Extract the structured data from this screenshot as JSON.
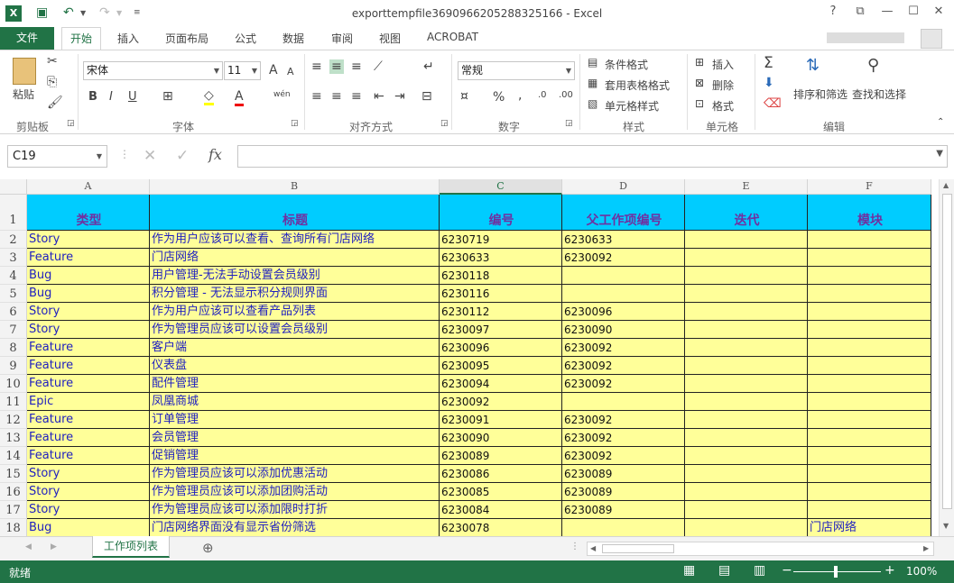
{
  "window": {
    "title": "exporttempfile3690966205288325166 - Excel",
    "help": "?",
    "restore_ribbon": "⧉",
    "minimize": "—",
    "maximize": "☐",
    "close": "✕"
  },
  "tabs": [
    "文件",
    "开始",
    "插入",
    "页面布局",
    "公式",
    "数据",
    "审阅",
    "视图",
    "ACROBAT"
  ],
  "ribbon": {
    "clipboard": {
      "paste": "粘贴",
      "group": "剪贴板"
    },
    "font": {
      "name": "宋体",
      "size": "11",
      "group": "字体",
      "bold": "B",
      "italic": "I",
      "underline": "U",
      "grow": "A",
      "shrink": "A",
      "color_a": "A",
      "phonetic": "wén"
    },
    "alignment": {
      "group": "对齐方式"
    },
    "number": {
      "format": "常规",
      "percent": "%",
      "comma": ",",
      "group": "数字"
    },
    "styles": {
      "conditional": "条件格式",
      "table": "套用表格格式",
      "cell": "单元格样式",
      "group": "样式"
    },
    "cells": {
      "insert": "插入",
      "delete": "删除",
      "format": "格式",
      "group": "单元格"
    },
    "editing": {
      "sort": "排序和筛选",
      "find": "查找和选择",
      "group": "编辑"
    }
  },
  "formula_bar": {
    "name_box": "C19",
    "fx": "fx",
    "value": ""
  },
  "columns": [
    "A",
    "B",
    "C",
    "D",
    "E",
    "F"
  ],
  "selected_column": "C",
  "headers": [
    "类型",
    "标题",
    "编号",
    "父工作项编号",
    "迭代",
    "模块"
  ],
  "rows": [
    {
      "n": "2",
      "cells": [
        "Story",
        "作为用户应该可以查看、查询所有门店网络",
        "6230719",
        "6230633",
        "",
        ""
      ]
    },
    {
      "n": "3",
      "cells": [
        "Feature",
        "门店网络",
        "6230633",
        "6230092",
        "",
        ""
      ]
    },
    {
      "n": "4",
      "cells": [
        "Bug",
        "用户管理-无法手动设置会员级别",
        "6230118",
        "",
        "",
        ""
      ]
    },
    {
      "n": "5",
      "cells": [
        "Bug",
        "积分管理 - 无法显示积分规则界面",
        "6230116",
        "",
        "",
        ""
      ]
    },
    {
      "n": "6",
      "cells": [
        "Story",
        "作为用户应该可以查看产品列表",
        "6230112",
        "6230096",
        "",
        ""
      ]
    },
    {
      "n": "7",
      "cells": [
        "Story",
        "作为管理员应该可以设置会员级别",
        "6230097",
        "6230090",
        "",
        ""
      ]
    },
    {
      "n": "8",
      "cells": [
        "Feature",
        "客户端",
        "6230096",
        "6230092",
        "",
        ""
      ]
    },
    {
      "n": "9",
      "cells": [
        "Feature",
        "仪表盘",
        "6230095",
        "6230092",
        "",
        ""
      ]
    },
    {
      "n": "10",
      "cells": [
        "Feature",
        "配件管理",
        "6230094",
        "6230092",
        "",
        ""
      ]
    },
    {
      "n": "11",
      "cells": [
        "Epic",
        "凤凰商城",
        "6230092",
        "",
        "",
        ""
      ]
    },
    {
      "n": "12",
      "cells": [
        "Feature",
        "订单管理",
        "6230091",
        "6230092",
        "",
        ""
      ]
    },
    {
      "n": "13",
      "cells": [
        "Feature",
        "会员管理",
        "6230090",
        "6230092",
        "",
        ""
      ]
    },
    {
      "n": "14",
      "cells": [
        "Feature",
        "促销管理",
        "6230089",
        "6230092",
        "",
        ""
      ]
    },
    {
      "n": "15",
      "cells": [
        "Story",
        "作为管理员应该可以添加优惠活动",
        "6230086",
        "6230089",
        "",
        ""
      ]
    },
    {
      "n": "16",
      "cells": [
        "Story",
        "作为管理员应该可以添加团购活动",
        "6230085",
        "6230089",
        "",
        ""
      ]
    },
    {
      "n": "17",
      "cells": [
        "Story",
        "作为管理员应该可以添加限时打折",
        "6230084",
        "6230089",
        "",
        ""
      ]
    },
    {
      "n": "18",
      "cells": [
        "Bug",
        "门店网络界面没有显示省份筛选",
        "6230078",
        "",
        "",
        "门店网络"
      ]
    }
  ],
  "header_row_number": "1",
  "sheet_tab": "工作项列表",
  "status": {
    "ready": "就绪",
    "zoom": "100%",
    "minus": "−",
    "plus": "+"
  },
  "colors": {
    "excel_green": "#217346",
    "header_fill": "#00ccff",
    "row_fill": "#ffff99",
    "header_text": "#7030a0",
    "cell_text": "#1f1fbf"
  }
}
